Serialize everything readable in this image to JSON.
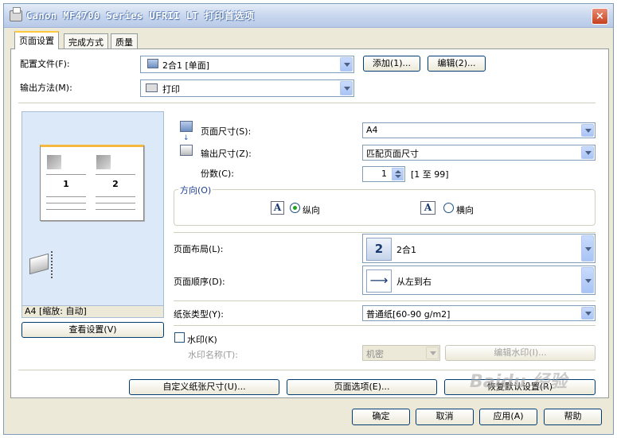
{
  "window": {
    "title": "Canon MF4700 Series UFRII LT 打印首选项",
    "close_glyph": "×"
  },
  "tabs": [
    {
      "label": "页面设置",
      "active": true
    },
    {
      "label": "完成方式",
      "active": false
    },
    {
      "label": "质量",
      "active": false
    }
  ],
  "profile": {
    "label": "配置文件(F):",
    "value": "2合1 [单面]",
    "add_button": "添加(1)...",
    "edit_button": "编辑(2)..."
  },
  "output_method": {
    "label": "输出方法(M):",
    "value": "打印"
  },
  "preview": {
    "page_numbers": [
      "1",
      "2"
    ],
    "status": "A4 [缩放: 自动]",
    "view_settings_button": "查看设置(V)"
  },
  "page_size": {
    "label": "页面尺寸(S):",
    "value": "A4"
  },
  "output_size": {
    "label": "输出尺寸(Z):",
    "value": "匹配页面尺寸"
  },
  "copies": {
    "label": "份数(C):",
    "value": "1",
    "range": "[1 至 99]"
  },
  "orientation": {
    "label": "方向(O)",
    "portrait_icon": "A",
    "portrait_label": "纵向",
    "portrait_selected": true,
    "landscape_icon": "A",
    "landscape_label": "横向",
    "landscape_selected": false
  },
  "page_layout": {
    "label": "页面布局(L):",
    "icon_text": "2",
    "value": "2合1"
  },
  "page_order": {
    "label": "页面顺序(D):",
    "value": "从左到右"
  },
  "paper_type": {
    "label": "纸张类型(Y):",
    "value": "普通纸[60-90 g/m2]"
  },
  "watermark": {
    "checkbox_label": "水印(K)",
    "checked": false,
    "name_label": "水印名称(T):",
    "name_value": "机密",
    "edit_button": "编辑水印(I)..."
  },
  "bottom_buttons": {
    "custom_paper": "自定义纸张尺寸(U)...",
    "page_options": "页面选项(E)...",
    "restore_defaults": "恢复默认设置(R)"
  },
  "dialog_buttons": {
    "ok": "确定",
    "cancel": "取消",
    "apply": "应用(A)",
    "help": "帮助"
  },
  "watermark_overlay": "Baidu 经验",
  "colors": {
    "dialog_bg": "#ece9d8",
    "preview_bg": "#dbe9f8",
    "tab_accent": "#ffc83c"
  }
}
